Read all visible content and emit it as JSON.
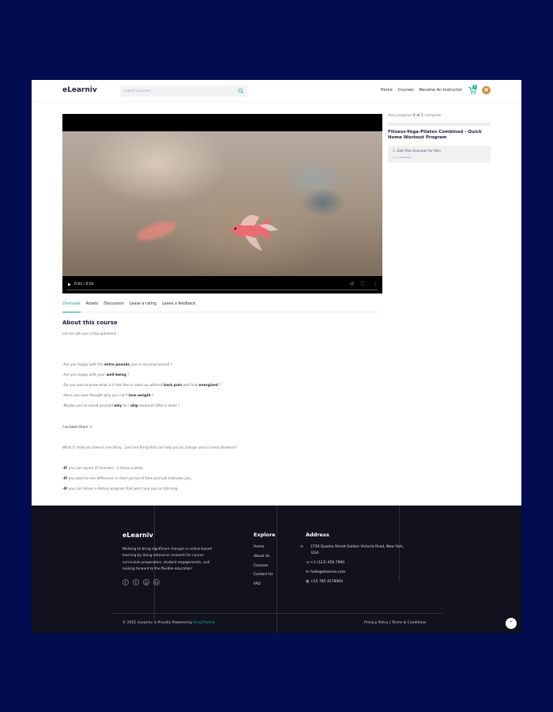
{
  "header": {
    "logo": "eLearniv",
    "search_placeholder": "Search Courses",
    "nav": [
      "Home",
      "Courses",
      "Become An Instructor"
    ],
    "cart_count": "0"
  },
  "video": {
    "time": "0:02 / 0:02"
  },
  "sidebar": {
    "progress_prefix": "Your progress",
    "progress_value": "0 of 1",
    "progress_suffix": "complete",
    "progress_fraction": 0,
    "course_title": "Fitness-Yoga-Pilates Combined - Quick Home Workout Program",
    "lesson": {
      "title": "1. Diet Plan Example for Men",
      "meta": "0 seconds"
    }
  },
  "tabs": [
    "Overview",
    "Assets",
    "Discussion",
    "Leave a rating",
    "Leave a feedback"
  ],
  "about": {
    "heading": "About this course",
    "intro": "Let me ask you a few questions ;",
    "q1_a": "-Are you happy with the ",
    "q1_b": "extra pounds",
    "q1_c": " you're carrying around ?",
    "q2_a": "-Are you happy with your ",
    "q2_b": "well-being",
    "q2_c": " ?",
    "q3_a": "-Do you wanna know what is it feel like to wake up without ",
    "q3_b": "back pain",
    "q3_c": " and fully ",
    "q3_d": "energized",
    "q3_e": " ?",
    "q4_a": "-Have you ever thought why you can't ",
    "q4_b": "lose weight",
    "q4_c": " ?",
    "q5_a": "-Maybe you've asked yourself ",
    "q5_b": "why",
    "q5_c": " do I ",
    "q5_d": "skip",
    "q5_e": " workouts after a while ?",
    "been_there": "I've been there :)",
    "what_if": "What if I told you there's one thing , just one thing that can help you to change your current situation?",
    "if1_a": "-IF",
    "if1_b": " you can spend 25 minutes , 3 times a week,",
    "if2_a": "-IF",
    "if2_b": " you want to see difference in short period of time and will motivate you,",
    "if3_a": "-IF",
    "if3_b": " you can follow a dietary program that won't put you on starving,"
  },
  "footer": {
    "logo": "eLearniv",
    "about": "Working to bring significant changes in online-based learning by doing extensive research for course curriculum preparation, student engagements, and looking forward to the flexible education!",
    "social": [
      "f",
      "t",
      "◎",
      "in"
    ],
    "explore_heading": "Explore",
    "explore_links": [
      "Home",
      "About Us",
      "Courses",
      "Contact Us",
      "FAQ"
    ],
    "address_heading": "Address",
    "address": "2750 Quadra Street Golden Victoria Road, New York, USA",
    "phone": "+1 (123) 456 7890",
    "email": "hello@elearniv.com",
    "fax": "+55 785 4578964",
    "copyright_a": "© 2022 eLearniv is Proudly Powered by ",
    "copyright_brand": "EnvyTheme",
    "privacy": "Privacy Policy",
    "separator": "|",
    "terms": "Terms & Conditions"
  }
}
